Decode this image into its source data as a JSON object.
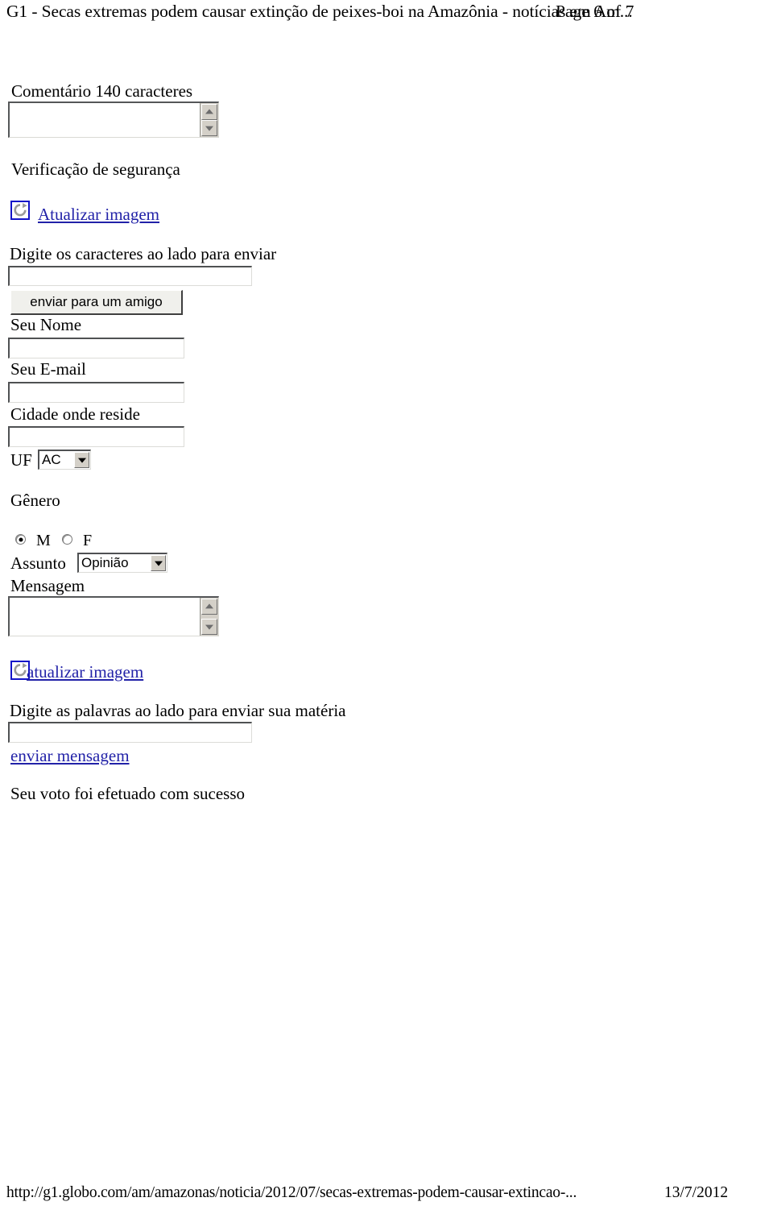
{
  "header": {
    "title": "G1 - Secas extremas podem causar extinção de peixes-boi na Amazônia - notícias em Am...",
    "page_indicator": "Page 6 of 7"
  },
  "form": {
    "comment_label": "Comentário 140 caracteres",
    "comment_value": "",
    "security_heading": "Verificação de segurança",
    "refresh_link_top": "Atualizar imagem",
    "captcha_top_label": "Digite os caracteres ao lado para enviar",
    "captcha_top_value": "",
    "send_friend_button": "enviar para um amigo",
    "name_label": "Seu Nome",
    "name_value": "",
    "email_label": "Seu E-mail",
    "email_value": "",
    "city_label": "Cidade onde reside",
    "city_value": "",
    "uf_label": "UF",
    "uf_value": "AC",
    "gender_label": "Gênero",
    "gender_male": "M",
    "gender_female": "F",
    "subject_label": "Assunto",
    "subject_value": "Opinião",
    "message_label": "Mensagem",
    "message_value": "",
    "refresh_link_bottom": "atualizar imagem",
    "captcha_bottom_label": "Digite as palavras ao lado para enviar sua matéria",
    "captcha_bottom_value": "",
    "send_message_link": "enviar mensagem",
    "vote_status": "Seu voto foi efetuado com sucesso"
  },
  "icons": {
    "refresh": "refresh-icon",
    "scroll_up": "scroll-up-arrow-icon",
    "scroll_down": "scroll-down-arrow-icon",
    "dropdown": "chevron-down-icon"
  },
  "colors": {
    "link": "#2222a8",
    "icon_border": "#1414c8",
    "text": "#000000",
    "control_face": "#d4d0c8"
  },
  "footer": {
    "url": "http://g1.globo.com/am/amazonas/noticia/2012/07/secas-extremas-podem-causar-extincao-...",
    "date": "13/7/2012"
  }
}
